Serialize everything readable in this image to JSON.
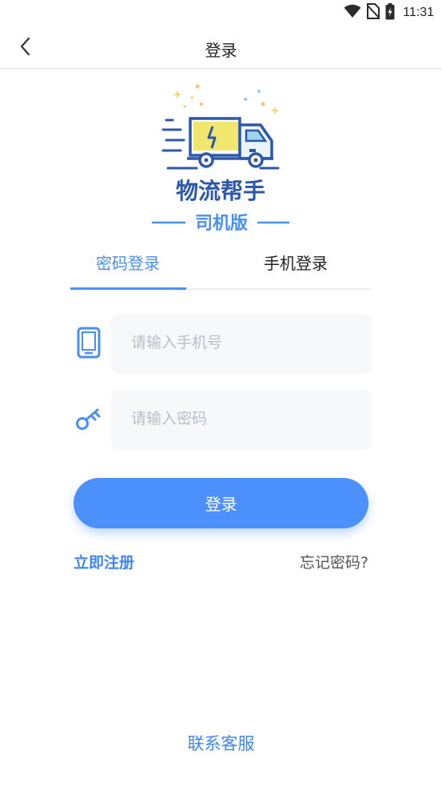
{
  "status_bar": {
    "time": "11:31",
    "icons": [
      "wifi-icon",
      "no-sim-icon",
      "battery-charging-icon"
    ]
  },
  "nav": {
    "title": "登录",
    "back_icon": "chevron-left-icon"
  },
  "logo": {
    "app_name": "物流帮手",
    "edition": "司机版",
    "brand_color": "#2d57a8",
    "accent_color": "#4a8ff6"
  },
  "tabs": [
    {
      "label": "密码登录",
      "active": true
    },
    {
      "label": "手机登录",
      "active": false
    }
  ],
  "form": {
    "phone_placeholder": "请输入手机号",
    "phone_value": "",
    "phone_icon": "phone-icon",
    "password_placeholder": "请输入密码",
    "password_value": "",
    "password_icon": "key-icon"
  },
  "actions": {
    "login_label": "登录",
    "register_label": "立即注册",
    "forgot_label": "忘记密码?",
    "service_label": "联系客服"
  },
  "colors": {
    "primary": "#4c90fb",
    "link": "#3f86f4",
    "input_bg": "#f7f8fa",
    "placeholder": "#b9bfc8"
  }
}
